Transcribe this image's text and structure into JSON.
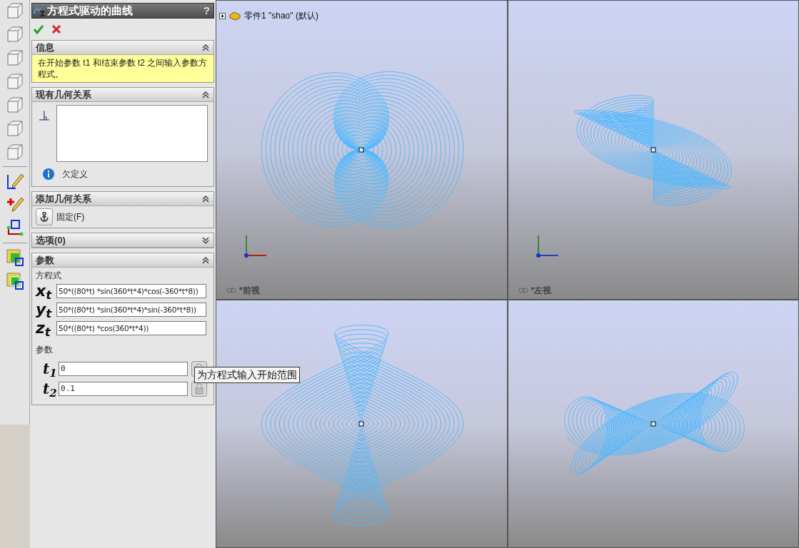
{
  "panel": {
    "title": "方程式驱动的曲线",
    "help": "?",
    "sections": [
      {
        "kind": "message",
        "title": "信息",
        "expanded": true,
        "text": "在开始参数 t1 和结束参数 t2 之间输入参数方程式。"
      },
      {
        "kind": "relations",
        "title": "现有几何关系",
        "expanded": true,
        "status": "欠定义"
      },
      {
        "kind": "add_relations",
        "title": "添加几何关系",
        "expanded": true,
        "items": [
          {
            "label": "固定(F)"
          }
        ]
      },
      {
        "title": "选项(0)",
        "expanded": false
      },
      {
        "kind": "parameters",
        "title": "参数",
        "expanded": true,
        "equation_label": "方程式",
        "equations": [
          {
            "symbol": "x$_{t}$",
            "value": "50*((80*t) *sin(360*t*4)*cos(-360*t*8))"
          },
          {
            "symbol": "y$_{t}$",
            "value": "50*((80*t) *sin(360*t*4)*sin(-360*t*8))"
          },
          {
            "symbol": "z$_{t}$",
            "value": "50*((80*t) *cos(360*t*4))"
          }
        ],
        "param_label": "参数",
        "params": [
          {
            "symbol": "t$_{1}$",
            "value": "0"
          },
          {
            "symbol": "t$_{2}$",
            "value": "0.1"
          }
        ]
      }
    ]
  },
  "tooltip": "为方程式输入开始范围",
  "tree": {
    "label": "零件1 \"shao\" (默认)",
    "expanded": false
  },
  "viewports": [
    {
      "label": "*前视",
      "kind": "front"
    },
    {
      "label": "*左视",
      "kind": "left"
    },
    {
      "kind": "top"
    },
    {
      "kind": "iso"
    }
  ]
}
